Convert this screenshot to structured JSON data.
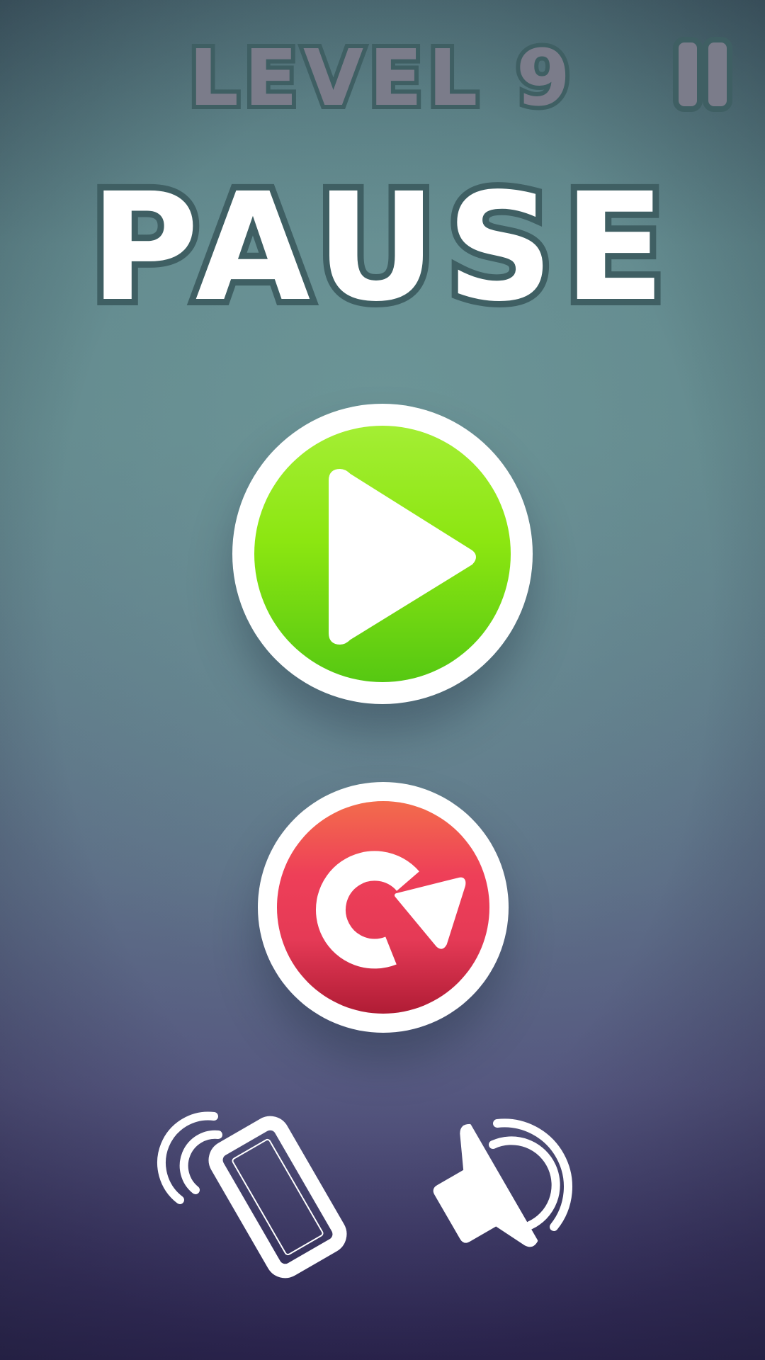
{
  "header": {
    "level_label": "LEVEL 9",
    "pause_icon": "pause-icon"
  },
  "title": "PAUSE",
  "buttons": {
    "play": {
      "icon": "play-icon",
      "color": "#8ce611"
    },
    "restart": {
      "icon": "restart-icon",
      "color": "#ee3f58"
    },
    "vibrate": {
      "icon": "vibrate-icon"
    },
    "sound": {
      "icon": "sound-icon"
    }
  },
  "colors": {
    "text_outline": "#3f5f63",
    "level_text": "#7b7c8a",
    "title_text": "#ffffff"
  }
}
